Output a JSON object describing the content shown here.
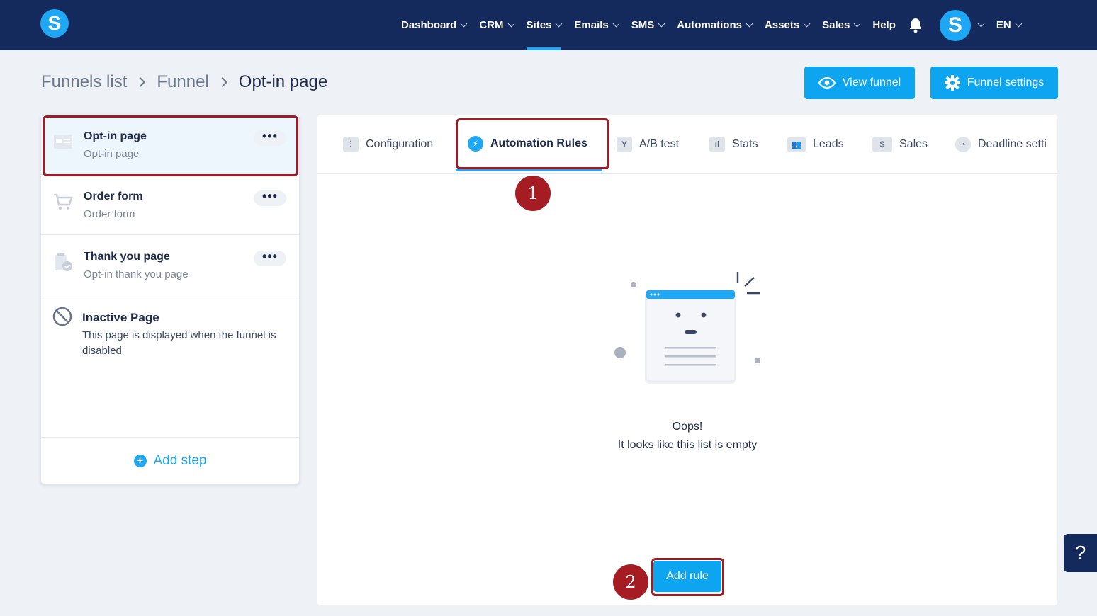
{
  "logo": {
    "letter": "S"
  },
  "nav": {
    "items": [
      {
        "label": "Dashboard",
        "has_dropdown": true
      },
      {
        "label": "CRM",
        "has_dropdown": true
      },
      {
        "label": "Sites",
        "has_dropdown": true,
        "active": true
      },
      {
        "label": "Emails",
        "has_dropdown": true
      },
      {
        "label": "SMS",
        "has_dropdown": true
      },
      {
        "label": "Automations",
        "has_dropdown": true
      },
      {
        "label": "Assets",
        "has_dropdown": true
      },
      {
        "label": "Sales",
        "has_dropdown": true
      },
      {
        "label": "Help",
        "has_dropdown": false
      }
    ],
    "avatar_letter": "S",
    "language": "EN"
  },
  "breadcrumb": [
    "Funnels list",
    "Funnel",
    "Opt-in page"
  ],
  "buttons": {
    "view_funnel": "View funnel",
    "funnel_settings": "Funnel settings"
  },
  "steps": [
    {
      "title": "Opt-in page",
      "subtitle": "Opt-in page",
      "icon": "page-layout-icon",
      "active": true
    },
    {
      "title": "Order form",
      "subtitle": "Order form",
      "icon": "cart-icon"
    },
    {
      "title": "Thank you page",
      "subtitle": "Opt-in thank you page",
      "icon": "clipboard-check-icon"
    }
  ],
  "inactive_page": {
    "title": "Inactive Page",
    "description": "This page is displayed when the funnel is disabled"
  },
  "add_step": "Add step",
  "tabs": [
    {
      "label": "Configuration",
      "icon": "sliders-icon"
    },
    {
      "label": "Automation Rules",
      "icon": "bolt-icon",
      "active": true
    },
    {
      "label": "A/B test",
      "icon": "split-icon"
    },
    {
      "label": "Stats",
      "icon": "bar-chart-icon"
    },
    {
      "label": "Leads",
      "icon": "users-icon"
    },
    {
      "label": "Sales",
      "icon": "dollar-icon"
    },
    {
      "label": "Deadline setti",
      "icon": "clock-icon"
    }
  ],
  "empty_state": {
    "line1": "Oops!",
    "line2": "It looks like this list is empty"
  },
  "add_rule": "Add rule",
  "annotations": [
    "1",
    "2"
  ],
  "help_fab": "?",
  "colors": {
    "nav_bg": "#142a5c",
    "accent": "#1ea7f5",
    "annotation": "#a51c22"
  }
}
